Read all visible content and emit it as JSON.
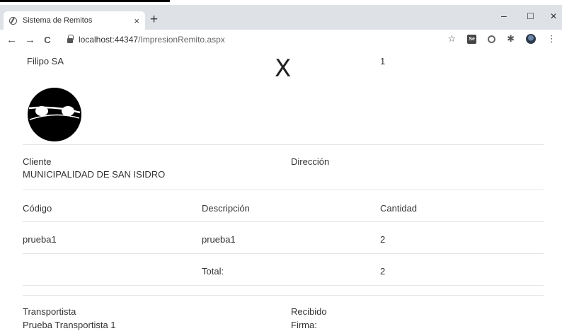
{
  "browser": {
    "tab_title": "Sistema de Remitos",
    "tab_close": "×",
    "new_tab": "+",
    "url_host": "localhost:44347",
    "url_path": "/ImpresionRemito.aspx",
    "window_minimize": "–",
    "window_maximize": "☐",
    "window_close": "✕",
    "nav_back": "←",
    "nav_forward": "→",
    "nav_reload": "C",
    "ext_label": "Se"
  },
  "remito": {
    "company": "Filipo SA",
    "type_letter": "X",
    "number": "1",
    "client_label": "Cliente",
    "client_value": "MUNICIPALIDAD DE SAN ISIDRO",
    "address_label": "Dirección",
    "address_value": "",
    "table": {
      "headers": [
        "Código",
        "Descripción",
        "Cantidad"
      ],
      "rows": [
        {
          "code": "prueba1",
          "description": "prueba1",
          "quantity": "2"
        }
      ],
      "total_label": "Total:",
      "total_value": "2"
    },
    "carrier_label": "Transportista",
    "carrier_value": "Prueba Transportista 1",
    "received_label": "Recibido",
    "signature_label": "Firma:"
  }
}
